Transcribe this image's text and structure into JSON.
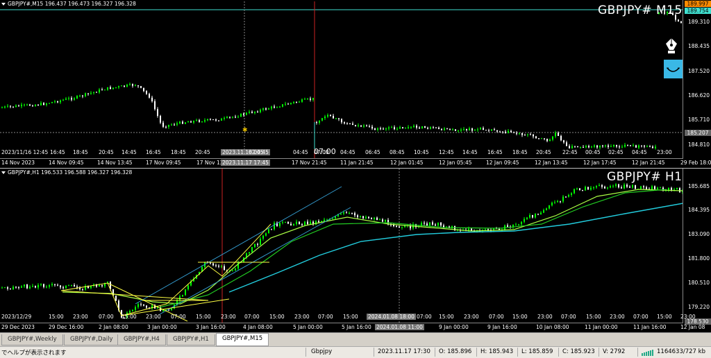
{
  "window1": {
    "ohlc_line": "GBPJPY#,M15  196.437 196.473 196.327 196.328",
    "title": "GBPJPY# M15",
    "price_labels": [
      "189.997",
      "189.754",
      "189.310",
      "188.435",
      "187.520",
      "186.620",
      "185.710",
      "185.207",
      "184.810"
    ],
    "time_labels_inner": [
      "2023/11/16 12:45",
      "16:45",
      "18:45",
      "20:45",
      "14:45",
      "16:45",
      "18:45",
      "20:45",
      "2023.11.18 00:45",
      "02:45",
      "04:45",
      "07:00",
      "04:45",
      "06:45",
      "08:45",
      "10:45",
      "12:45",
      "14:45",
      "16:45",
      "18:45",
      "20:45",
      "22:45",
      "00:45",
      "02:45",
      "04:45",
      "23:00"
    ],
    "time_labels_axis": [
      "14 Nov 2023",
      "14 Nov 09:45",
      "14 Nov 13:45",
      "17 Nov 09:45",
      "17 Nov 13",
      "2023.11.17 17:45",
      "17 Nov 21:45",
      "11 Jan 21:45",
      "12 Jan 01:45",
      "12 Jan 05:45",
      "12 Jan 09:45",
      "12 Jan 13:45",
      "12 Jan 17:45",
      "12 Jan 21:45",
      "29 Feb 18:00"
    ]
  },
  "window2": {
    "ohlc_line": "GBPJPY#,H1  196.533 196.588 196.327 196.328",
    "title": "GBPJPY# H1",
    "price_labels": [
      "185.685",
      "184.395",
      "183.090",
      "181.800",
      "180.510",
      "179.220",
      "178.530"
    ],
    "time_labels_inner": [
      "2023/12/29",
      "15:00",
      "23:00",
      "07:00",
      "15:00",
      "23:00",
      "07:00",
      "15:00",
      "23:00",
      "07:00",
      "15:00",
      "23:00",
      "07:00",
      "15:00",
      "2024.01.08 18:00",
      "07:00",
      "15:00",
      "23:00",
      "07:00",
      "15:00",
      "23:00",
      "07:00",
      "15:00",
      "23:00",
      "07:00",
      "15:00",
      "23:00"
    ],
    "time_labels_axis": [
      "29 Dec 2023",
      "29 Dec 16:00",
      "2 Jan 08:00",
      "3 Jan 00:00",
      "3 Jan 16:00",
      "4 Jan 08:00",
      "5 Jan 00:00",
      "5 Jan 16:00",
      "2024.01.08 11:00",
      "9 Jan 00:00",
      "9 Jan 16:00",
      "10 Jan 08:00",
      "11 Jan 00:00",
      "11 Jan 16:00",
      "12 Jan 08"
    ]
  },
  "tabs": [
    "GBPJPY#,Weekly",
    "GBPJPY#,Daily",
    "GBPJPY#,H4",
    "GBPJPY#,H1",
    "GBPJPY#,M15"
  ],
  "status": {
    "help": "でヘルプが表示されます",
    "symbol": "Gbpjpy",
    "datetime": "2023.11.17 17:30",
    "open": "O: 185.896",
    "high": "H: 185.943",
    "low": "L: 185.859",
    "close": "C: 185.923",
    "volume": "V: 2792",
    "traffic": "1164633/727 kb"
  },
  "colors": {
    "background": "#000000",
    "bull": "#00ff00",
    "bear": "#ffffff",
    "ma_fast": "#aaff44",
    "ma_mid": "#22cc22",
    "ma_slow": "#22ccdd",
    "fib": "#ffff44",
    "vline_red": "#cc2222"
  },
  "icons": [
    "pen-icon",
    "smile-icon",
    "dropdown-triangle-icon",
    "connection-bars-icon"
  ]
}
